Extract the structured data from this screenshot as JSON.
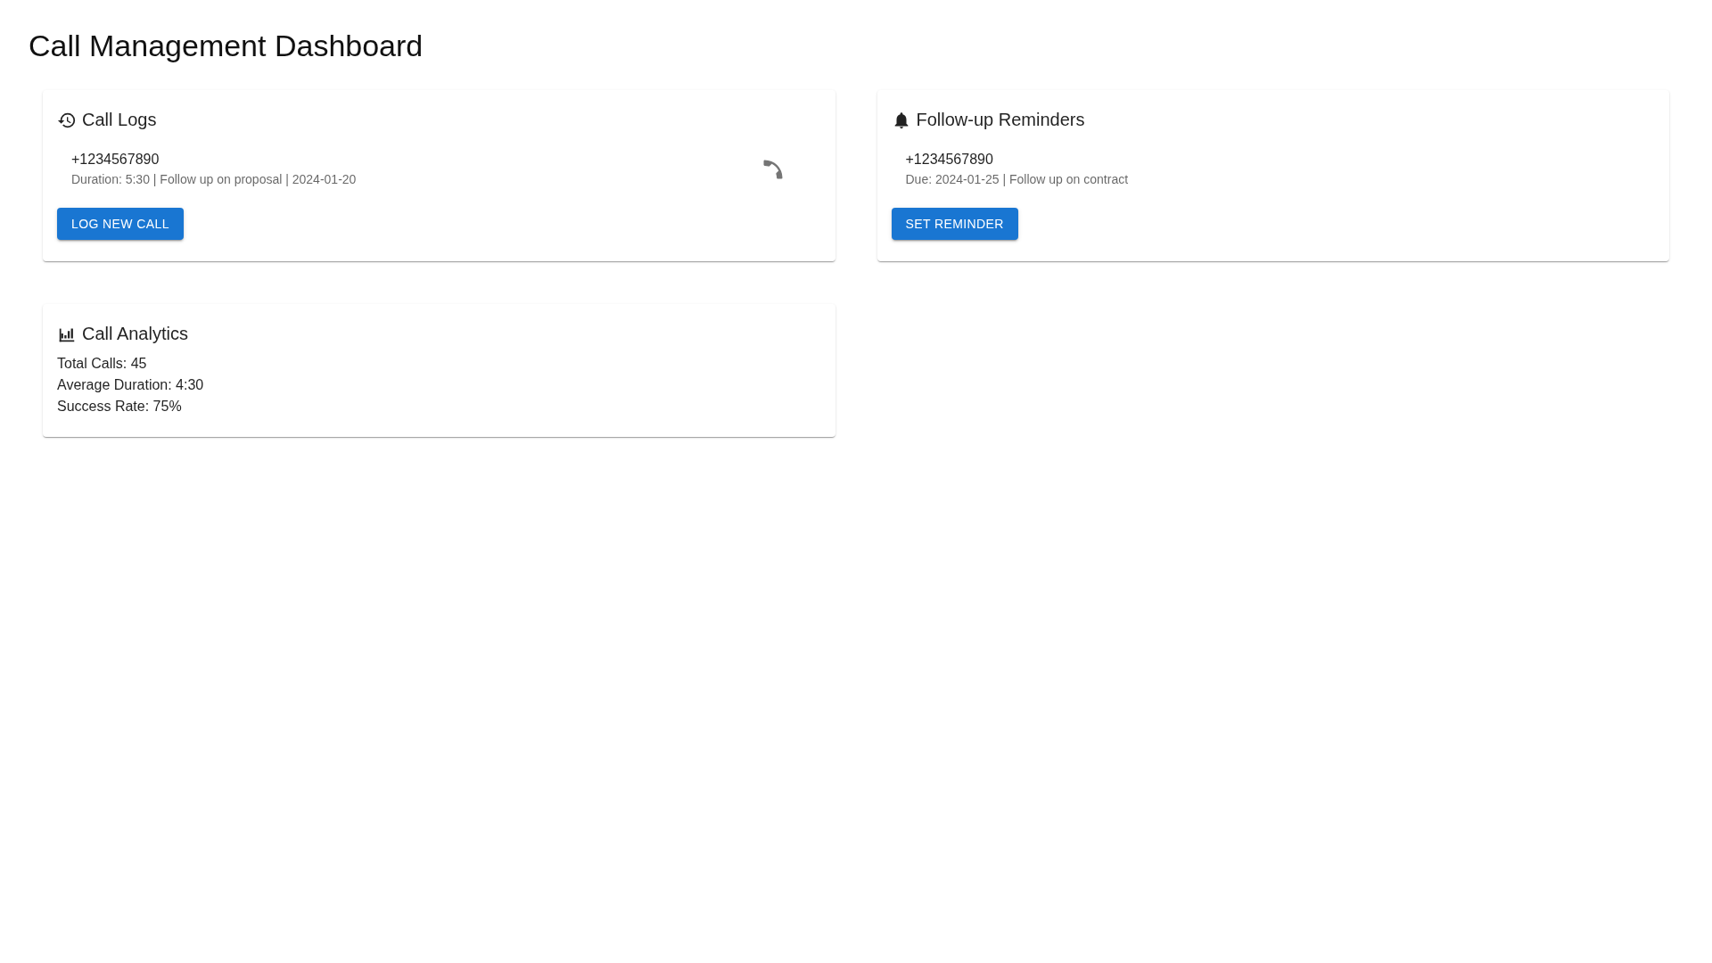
{
  "title": "Call Management Dashboard",
  "cards": [
    {
      "kind": "list",
      "title": "Call Logs",
      "items": [
        {
          "kind": "call",
          "primary": "+1234567890",
          "secondary": "Duration: 5:30 | Follow up on proposal | 2024-01-20"
        }
      ],
      "button": "LOG NEW CALL"
    },
    {
      "kind": "list",
      "title": "Follow-up Reminders",
      "items": [
        {
          "kind": "reminder",
          "primary": "+1234567890",
          "secondary": "Due: 2024-01-25 | Follow up on contract"
        }
      ],
      "button": "SET REMINDER"
    },
    {
      "kind": "stats",
      "title": "Call Analytics",
      "lines": [
        "Total Calls: 45",
        "Average Duration: 4:30",
        "Success Rate: 75%"
      ]
    }
  ]
}
